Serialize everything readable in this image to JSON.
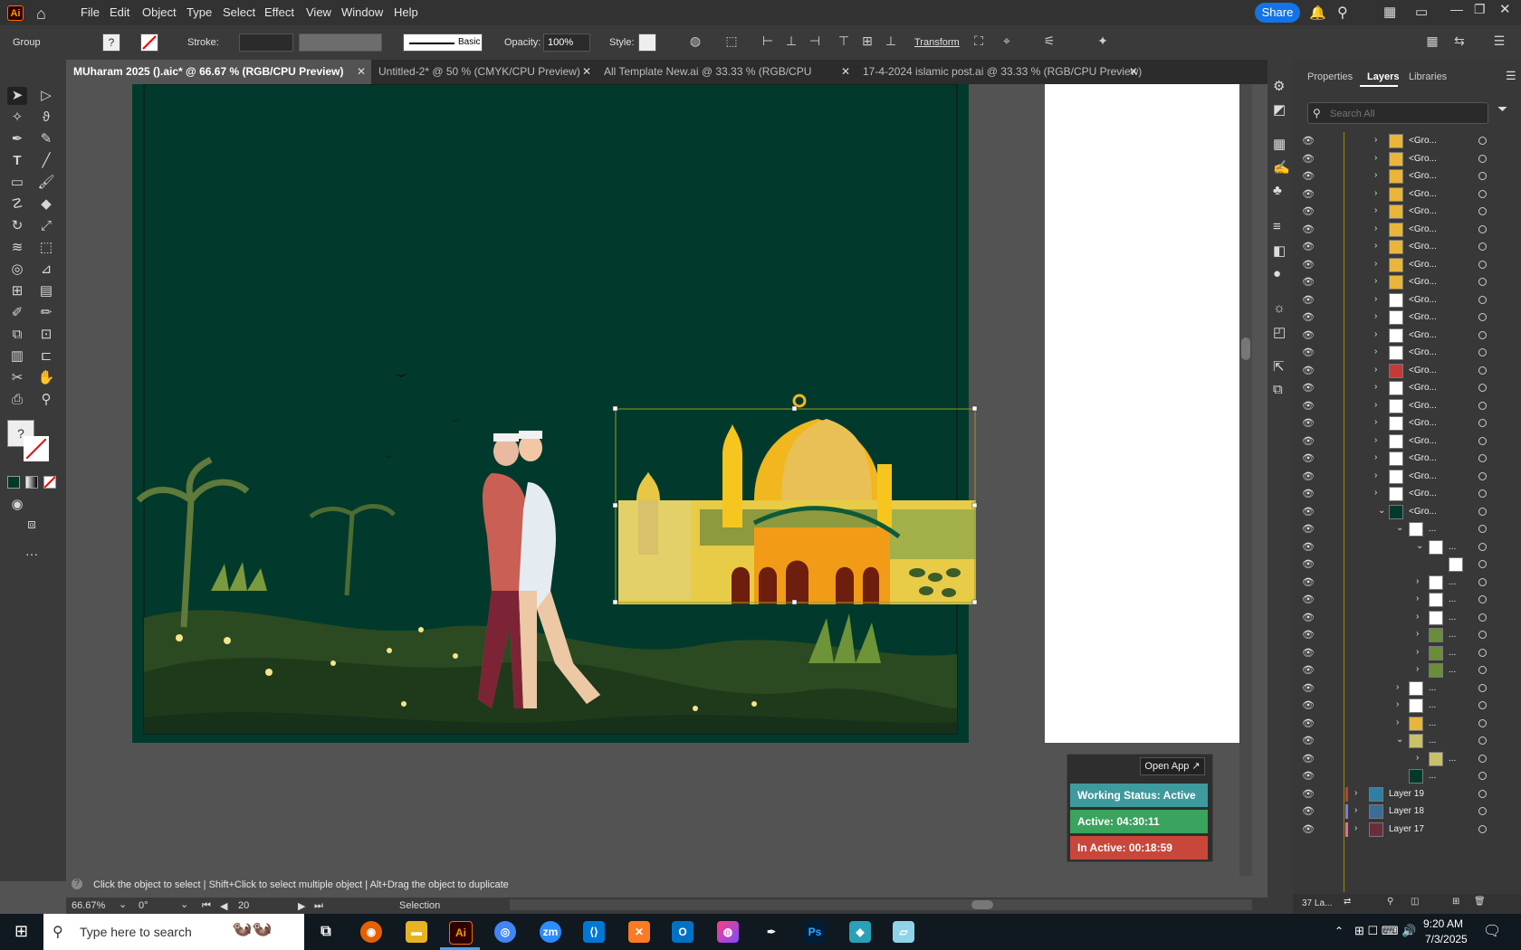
{
  "menu": {
    "app_icon_label": "Ai",
    "items": [
      "File",
      "Edit",
      "Object",
      "Type",
      "Select",
      "Effect",
      "View",
      "Window",
      "Help"
    ],
    "share_label": "Share"
  },
  "control_bar": {
    "selection_label": "Group",
    "stroke_label": "Stroke:",
    "brush_label": "Basic",
    "opacity_label": "Opacity:",
    "opacity_value": "100%",
    "style_label": "Style:",
    "transform_label": "Transform"
  },
  "tabs": [
    {
      "label": "MUharam 2025 ().aic* @ 66.67 % (RGB/CPU Preview)"
    },
    {
      "label": "Untitled-2* @ 50 % (CMYK/CPU Preview)"
    },
    {
      "label": "All Template New.ai @ 33.33 % (RGB/CPU Preview)"
    },
    {
      "label": "17-4-2024 islamic post.ai @ 33.33 % (RGB/CPU Preview)"
    }
  ],
  "status_bar": {
    "hint": "Click the object to select  |  Shift+Click to select multiple object  |  Alt+Drag the object to duplicate"
  },
  "bottom_bar": {
    "zoom": "66.67%",
    "rotation": "0°",
    "artboard": "20",
    "tool": "Selection"
  },
  "panel": {
    "tabs": [
      "Properties",
      "Layers",
      "Libraries"
    ],
    "search_placeholder": "Search All",
    "group_label": "<Gro...",
    "ellipsis": "...",
    "layers": [
      "Layer 19",
      "Layer 18",
      "Layer 17"
    ],
    "layer_count": "37 La..."
  },
  "widget": {
    "open_app": "Open App ↗",
    "working_status": "Working Status: Active",
    "active": "Active: 04:30:11",
    "inactive": "In Active: 00:18:59",
    "colors": {
      "status": "#3e9a9d",
      "active": "#3aa35e",
      "inactive": "#c9463a"
    }
  },
  "taskbar": {
    "search_placeholder": "Type here to search",
    "time": "9:20 AM",
    "date": "7/3/2025",
    "apps": [
      "Ai",
      "Ps"
    ]
  },
  "colors": {
    "artboard_bg": "#013a2c",
    "accent": "#1473e6"
  }
}
